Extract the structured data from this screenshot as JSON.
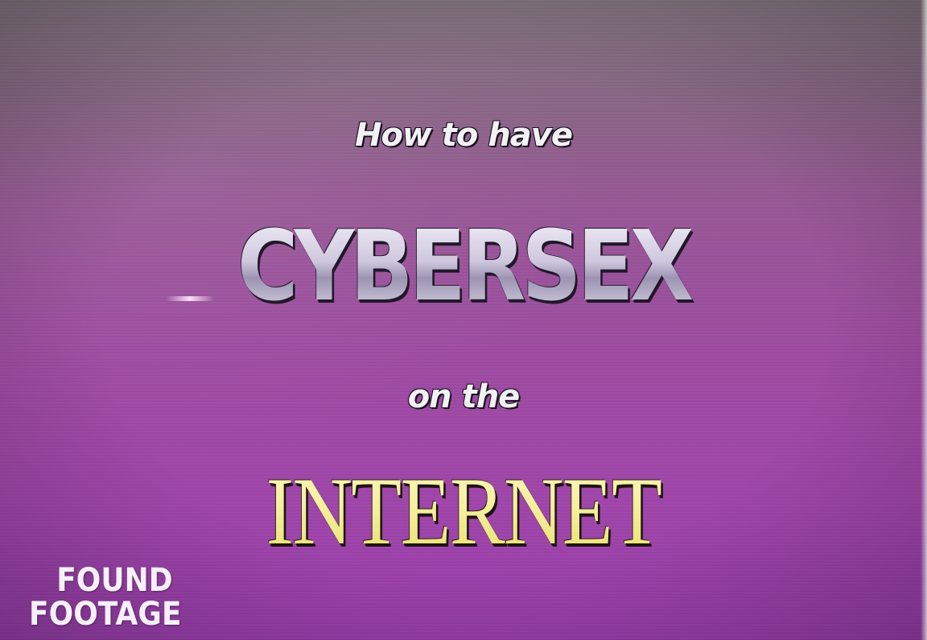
{
  "title": {
    "line1": "How to have",
    "line2": "CYBERSEX",
    "line3": "on the",
    "line4": "INTERNET"
  },
  "watermark": {
    "line1": "FOUND",
    "line2": "FOOTAGE"
  },
  "colors": {
    "background_top": "#847680",
    "background_bottom": "#9a3fad",
    "cybersex_text": "#d8d4e6",
    "internet_text": "#f4ee9a",
    "small_text": "#f2f2f4"
  }
}
